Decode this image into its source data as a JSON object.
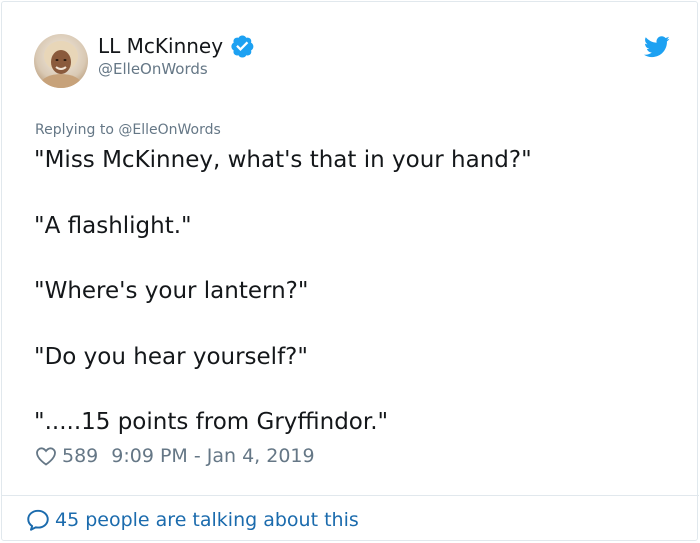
{
  "author": {
    "name": "LL McKinney",
    "handle": "@ElleOnWords",
    "verified": true
  },
  "reply": {
    "label": "Replying to @ElleOnWords"
  },
  "tweet": {
    "lines": [
      "\"Miss McKinney, what's that in your hand?\"",
      "\"A flashlight.\"",
      "\"Where's your lantern?\"",
      "\"Do you hear yourself?\"",
      "\".....15 points from Gryffindor.\""
    ]
  },
  "meta": {
    "likes": "589",
    "timestamp": "9:09 PM - Jan 4, 2019"
  },
  "footer": {
    "talking_label": "45 people are talking about this"
  },
  "colors": {
    "text": "#14171a",
    "secondary": "#657786",
    "link": "#1b6bad",
    "twitter_blue": "#1da1f2",
    "border": "#e1e8ed"
  },
  "icons": {
    "verified": "verified-badge-icon",
    "brand": "twitter-bird-icon",
    "like": "heart-icon",
    "talking": "speech-bubble-icon"
  }
}
